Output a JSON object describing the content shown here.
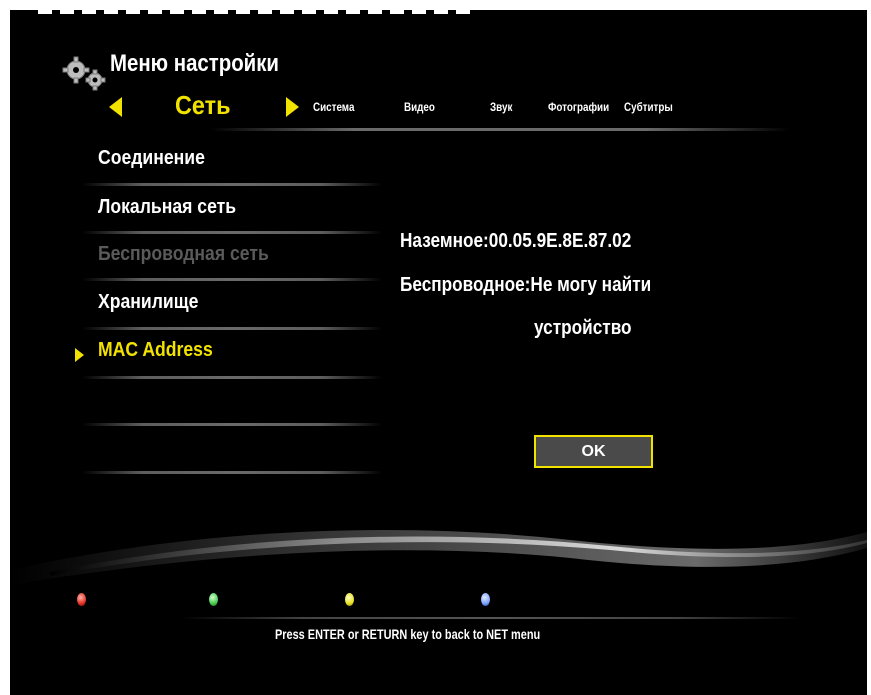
{
  "header": {
    "title": "Меню настройки",
    "icon": "gears-icon"
  },
  "tabs": {
    "active": "Сеть",
    "items": [
      "Система",
      "Видео",
      "Звук",
      "Фотографии",
      "Субтитры"
    ]
  },
  "menu": {
    "items": [
      {
        "label": "Соединение",
        "state": "normal"
      },
      {
        "label": "Локальная сеть",
        "state": "normal"
      },
      {
        "label": "Беспроводная сеть",
        "state": "disabled"
      },
      {
        "label": "Хранилище",
        "state": "normal"
      },
      {
        "label": "MAC Address",
        "state": "selected"
      }
    ]
  },
  "mac_info": {
    "wired": "Наземное:00.05.9E.8E.87.02",
    "wireless_line1": "Беспроводное:Не могу найти",
    "wireless_line2": "устройство"
  },
  "dialog": {
    "ok_label": "OK"
  },
  "color_buttons": [
    "red",
    "green",
    "yellow",
    "blue"
  ],
  "footer": {
    "hint": "Press ENTER or RETURN key to back to NET menu"
  },
  "colors": {
    "accent": "#f2e200",
    "background": "#000000",
    "disabled": "#5a5a5a"
  }
}
